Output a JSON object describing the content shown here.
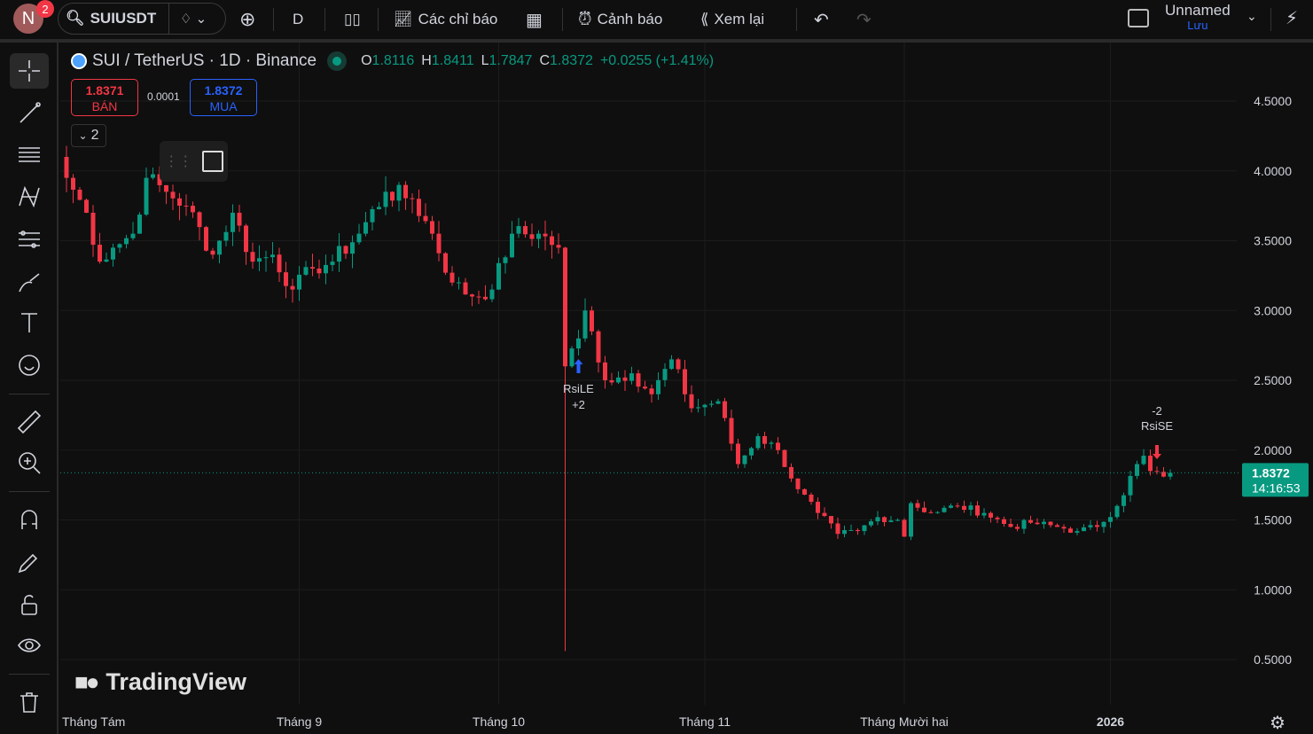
{
  "topbar": {
    "avatar_letter": "N",
    "notifications": "2",
    "symbol": "SUIUSDT",
    "interval": "D",
    "indicators_label": "Các chỉ báo",
    "alerts_label": "Cảnh báo",
    "replay_label": "Xem lại",
    "layout_name": "Unnamed",
    "save_label": "Lưu"
  },
  "legend": {
    "title": "SUI / TetherUS · 1D · Binance",
    "o_label": "O",
    "o": "1.8116",
    "h_label": "H",
    "h": "1.8411",
    "l_label": "L",
    "l": "1.7847",
    "c_label": "C",
    "c": "1.8372",
    "change": "+0.0255 (+1.41%)"
  },
  "trade": {
    "sell_price": "1.8371",
    "sell_label": "BÁN",
    "spread": "0.0001",
    "buy_price": "1.8372",
    "buy_label": "MUA"
  },
  "collapse_count": "2",
  "logo_text": "TradingView",
  "colors": {
    "up": "#089981",
    "down": "#f23645",
    "accent": "#2962ff"
  },
  "chart_data": {
    "type": "candlestick",
    "ylim": [
      0.3,
      4.8
    ],
    "y_ticks": [
      "4.5000",
      "4.0000",
      "3.5000",
      "3.0000",
      "2.5000",
      "2.0000",
      "1.5000",
      "1.0000",
      "0.5000"
    ],
    "y_tick_values": [
      4.5,
      4.0,
      3.5,
      3.0,
      2.5,
      2.0,
      1.5,
      1.0,
      0.5
    ],
    "x_ticks": [
      {
        "day": 35,
        "label": "Tháng 9"
      },
      {
        "day": 65,
        "label": "Tháng 10"
      },
      {
        "day": 96,
        "label": "Tháng 11"
      },
      {
        "day": 126,
        "label": "Tháng Mười hai"
      },
      {
        "day": 157,
        "label": "2026"
      }
    ],
    "x_first_label": "Tháng Tám",
    "close_keypoints": [
      [
        0,
        3.95
      ],
      [
        3,
        3.7
      ],
      [
        5,
        3.35
      ],
      [
        7,
        3.45
      ],
      [
        10,
        3.55
      ],
      [
        12,
        3.95
      ],
      [
        15,
        3.85
      ],
      [
        18,
        3.75
      ],
      [
        22,
        3.4
      ],
      [
        25,
        3.7
      ],
      [
        28,
        3.35
      ],
      [
        31,
        3.4
      ],
      [
        34,
        3.15
      ],
      [
        37,
        3.3
      ],
      [
        40,
        3.35
      ],
      [
        44,
        3.55
      ],
      [
        48,
        3.85
      ],
      [
        52,
        3.8
      ],
      [
        55,
        3.55
      ],
      [
        58,
        3.2
      ],
      [
        61,
        3.1
      ],
      [
        64,
        3.15
      ],
      [
        67,
        3.55
      ],
      [
        71,
        3.55
      ],
      [
        74,
        3.45
      ],
      [
        75,
        2.6
      ],
      [
        77,
        2.8
      ],
      [
        78,
        3.0
      ],
      [
        81,
        2.5
      ],
      [
        85,
        2.55
      ],
      [
        88,
        2.4
      ],
      [
        91,
        2.65
      ],
      [
        94,
        2.3
      ],
      [
        98,
        2.35
      ],
      [
        101,
        1.9
      ],
      [
        104,
        2.1
      ],
      [
        107,
        2.0
      ],
      [
        110,
        1.72
      ],
      [
        113,
        1.55
      ],
      [
        116,
        1.4
      ],
      [
        119,
        1.42
      ],
      [
        122,
        1.52
      ],
      [
        125,
        1.5
      ],
      [
        126,
        1.38
      ],
      [
        127,
        1.62
      ],
      [
        130,
        1.55
      ],
      [
        134,
        1.6
      ],
      [
        138,
        1.55
      ],
      [
        142,
        1.45
      ],
      [
        145,
        1.48
      ],
      [
        149,
        1.45
      ],
      [
        152,
        1.42
      ],
      [
        155,
        1.45
      ],
      [
        158,
        1.6
      ],
      [
        161,
        1.9
      ],
      [
        162,
        1.96
      ],
      [
        163,
        1.85
      ],
      [
        165,
        1.81
      ],
      [
        166,
        1.8372
      ]
    ],
    "low_overrides": [
      [
        75,
        0.56
      ]
    ],
    "last_price": "1.8372",
    "countdown": "14:16:53",
    "signals": [
      {
        "day": 77,
        "name": "RsiLE",
        "qty": "+2",
        "side": "buy"
      },
      {
        "day": 164,
        "name": "RsiSE",
        "qty": "-2",
        "side": "sell"
      }
    ]
  }
}
